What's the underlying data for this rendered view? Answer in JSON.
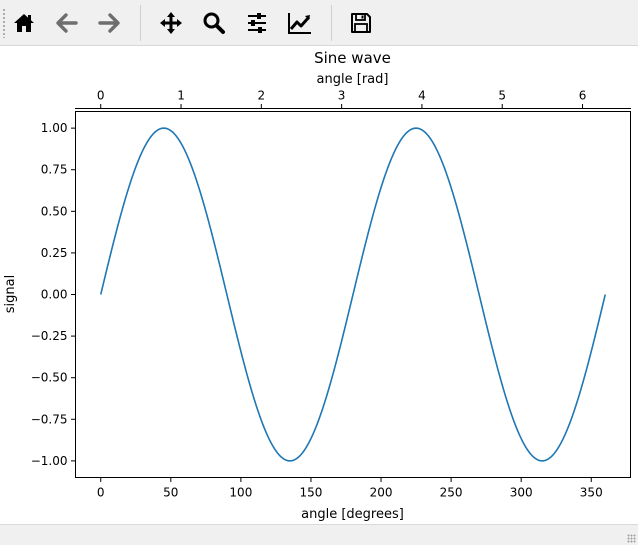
{
  "toolbar": {
    "buttons": [
      {
        "name": "home-button",
        "icon": "home-icon"
      },
      {
        "name": "back-button",
        "icon": "arrow-left-icon"
      },
      {
        "name": "forward-button",
        "icon": "arrow-right-icon"
      },
      {
        "name": "pan-button",
        "icon": "move-arrows-icon"
      },
      {
        "name": "zoom-button",
        "icon": "magnifier-icon"
      },
      {
        "name": "configure-subplots-button",
        "icon": "sliders-icon"
      },
      {
        "name": "edit-axes-button",
        "icon": "line-chart-icon"
      },
      {
        "name": "save-button",
        "icon": "floppy-disk-icon"
      }
    ]
  },
  "chart_data": {
    "type": "line",
    "title": "Sine wave",
    "xlabel": "angle [degrees]",
    "ylabel": "signal",
    "secondary_xlabel": "angle [rad]",
    "xlim": [
      -18,
      378
    ],
    "ylim": [
      -1.1,
      1.1
    ],
    "xticks": [
      "0",
      "50",
      "100",
      "150",
      "200",
      "250",
      "300",
      "350"
    ],
    "xtick_values": [
      0,
      50,
      100,
      150,
      200,
      250,
      300,
      350
    ],
    "yticks": [
      "−1.00",
      "−0.75",
      "−0.50",
      "−0.25",
      "0.00",
      "0.25",
      "0.50",
      "0.75",
      "1.00"
    ],
    "ytick_values": [
      -1,
      -0.75,
      -0.5,
      -0.25,
      0,
      0.25,
      0.5,
      0.75,
      1
    ],
    "secondary_xticks": [
      "0",
      "1",
      "2",
      "3",
      "4",
      "5",
      "6"
    ],
    "secondary_xtick_values": [
      0,
      1,
      2,
      3,
      4,
      5,
      6
    ],
    "series": [
      {
        "function": "sin(2 * x * pi / 180)",
        "x_start": 0,
        "x_end": 360,
        "color": "#1f77b4"
      }
    ],
    "grid": false
  },
  "colors": {
    "line": "#1f77b4",
    "toolbar": "#f0f0f0"
  }
}
